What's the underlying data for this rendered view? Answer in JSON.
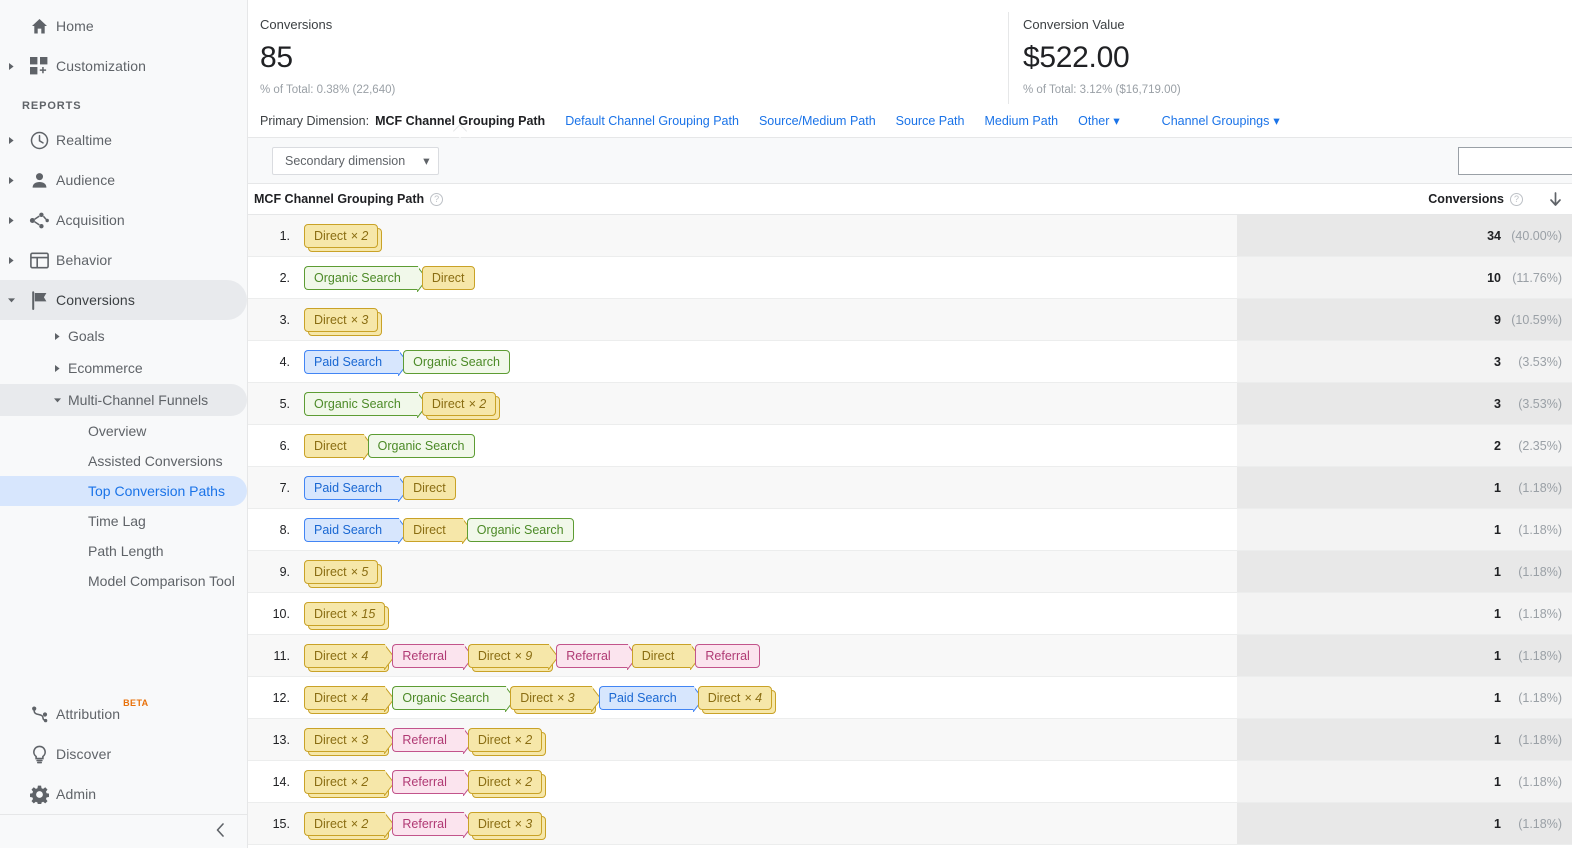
{
  "sidebar": {
    "top_items": [
      {
        "label": "Home",
        "icon": "home-icon",
        "expandable": false
      },
      {
        "label": "Customization",
        "icon": "customization-icon",
        "expandable": true
      }
    ],
    "section_label": "REPORTS",
    "report_items": [
      {
        "label": "Realtime",
        "icon": "clock-icon",
        "expandable": true,
        "active": false
      },
      {
        "label": "Audience",
        "icon": "person-icon",
        "expandable": true,
        "active": false
      },
      {
        "label": "Acquisition",
        "icon": "acquisition-icon",
        "expandable": true,
        "active": false
      },
      {
        "label": "Behavior",
        "icon": "behavior-icon",
        "expandable": true,
        "active": false
      },
      {
        "label": "Conversions",
        "icon": "flag-icon",
        "expandable": true,
        "active": true
      }
    ],
    "conversions_subitems": [
      {
        "label": "Goals",
        "expanded": false
      },
      {
        "label": "Ecommerce",
        "expanded": false
      },
      {
        "label": "Multi-Channel Funnels",
        "expanded": true
      }
    ],
    "mcf_leaves": [
      {
        "label": "Overview",
        "selected": false
      },
      {
        "label": "Assisted Conversions",
        "selected": false
      },
      {
        "label": "Top Conversion Paths",
        "selected": true
      },
      {
        "label": "Time Lag",
        "selected": false
      },
      {
        "label": "Path Length",
        "selected": false
      },
      {
        "label": "Model Comparison Tool",
        "selected": false
      }
    ],
    "bottom_items": [
      {
        "label": "Attribution",
        "icon": "attribution-icon",
        "badge": "BETA"
      },
      {
        "label": "Discover",
        "icon": "bulb-icon",
        "badge": ""
      },
      {
        "label": "Admin",
        "icon": "gear-icon",
        "badge": ""
      }
    ],
    "collapse_icon": "chevron-left-icon"
  },
  "summary": {
    "conversions": {
      "title": "Conversions",
      "value": "85",
      "percent_of_total": "% of Total: 0.38% (22,640)"
    },
    "conversion_value": {
      "title": "Conversion Value",
      "value": "$522.00",
      "percent_of_total": "% of Total: 3.12% ($16,719.00)"
    }
  },
  "dimension_bar": {
    "lead_label": "Primary Dimension:",
    "tabs": [
      {
        "label": "MCF Channel Grouping Path",
        "active": true,
        "caret": false
      },
      {
        "label": "Default Channel Grouping Path",
        "active": false,
        "caret": false
      },
      {
        "label": "Source/Medium Path",
        "active": false,
        "caret": false
      },
      {
        "label": "Source Path",
        "active": false,
        "caret": false
      },
      {
        "label": "Medium Path",
        "active": false,
        "caret": false
      },
      {
        "label": "Other",
        "active": false,
        "caret": true
      }
    ],
    "channel_groupings": {
      "label": "Channel Groupings",
      "caret": true
    }
  },
  "controls": {
    "secondary_dimension_label": "Secondary dimension",
    "search_value": "",
    "search_placeholder": ""
  },
  "table": {
    "col_path_header": "MCF Channel Grouping Path",
    "col_conv_header": "Conversions",
    "help_glyph": "?",
    "sort_icon": "arrow-down-icon",
    "rows": [
      {
        "rank": "1.",
        "conversions": "34",
        "percent": "(40.00%)",
        "path": [
          {
            "label": "Direct",
            "mult": "× 2",
            "color": "direct",
            "terminal": true
          }
        ]
      },
      {
        "rank": "2.",
        "conversions": "10",
        "percent": "(11.76%)",
        "path": [
          {
            "label": "Organic Search",
            "mult": "",
            "color": "organic",
            "terminal": false
          },
          {
            "label": "Direct",
            "mult": "",
            "color": "direct",
            "terminal": true
          }
        ]
      },
      {
        "rank": "3.",
        "conversions": "9",
        "percent": "(10.59%)",
        "path": [
          {
            "label": "Direct",
            "mult": "× 3",
            "color": "direct",
            "terminal": true
          }
        ]
      },
      {
        "rank": "4.",
        "conversions": "3",
        "percent": "(3.53%)",
        "path": [
          {
            "label": "Paid Search",
            "mult": "",
            "color": "paid",
            "terminal": false
          },
          {
            "label": "Organic Search",
            "mult": "",
            "color": "organic",
            "terminal": true
          }
        ]
      },
      {
        "rank": "5.",
        "conversions": "3",
        "percent": "(3.53%)",
        "path": [
          {
            "label": "Organic Search",
            "mult": "",
            "color": "organic",
            "terminal": false
          },
          {
            "label": "Direct",
            "mult": "× 2",
            "color": "direct",
            "terminal": true
          }
        ]
      },
      {
        "rank": "6.",
        "conversions": "2",
        "percent": "(2.35%)",
        "path": [
          {
            "label": "Direct",
            "mult": "",
            "color": "direct",
            "terminal": false
          },
          {
            "label": "Organic Search",
            "mult": "",
            "color": "organic",
            "terminal": true
          }
        ]
      },
      {
        "rank": "7.",
        "conversions": "1",
        "percent": "(1.18%)",
        "path": [
          {
            "label": "Paid Search",
            "mult": "",
            "color": "paid",
            "terminal": false
          },
          {
            "label": "Direct",
            "mult": "",
            "color": "direct",
            "terminal": true
          }
        ]
      },
      {
        "rank": "8.",
        "conversions": "1",
        "percent": "(1.18%)",
        "path": [
          {
            "label": "Paid Search",
            "mult": "",
            "color": "paid",
            "terminal": false
          },
          {
            "label": "Direct",
            "mult": "",
            "color": "direct",
            "terminal": false
          },
          {
            "label": "Organic Search",
            "mult": "",
            "color": "organic",
            "terminal": true
          }
        ]
      },
      {
        "rank": "9.",
        "conversions": "1",
        "percent": "(1.18%)",
        "path": [
          {
            "label": "Direct",
            "mult": "× 5",
            "color": "direct",
            "terminal": true
          }
        ]
      },
      {
        "rank": "10.",
        "conversions": "1",
        "percent": "(1.18%)",
        "path": [
          {
            "label": "Direct",
            "mult": "× 15",
            "color": "direct",
            "terminal": true
          }
        ]
      },
      {
        "rank": "11.",
        "conversions": "1",
        "percent": "(1.18%)",
        "path": [
          {
            "label": "Direct",
            "mult": "× 4",
            "color": "direct",
            "terminal": false
          },
          {
            "label": "Referral",
            "mult": "",
            "color": "referral",
            "terminal": false
          },
          {
            "label": "Direct",
            "mult": "× 9",
            "color": "direct",
            "terminal": false
          },
          {
            "label": "Referral",
            "mult": "",
            "color": "referral",
            "terminal": false
          },
          {
            "label": "Direct",
            "mult": "",
            "color": "direct",
            "terminal": false
          },
          {
            "label": "Referral",
            "mult": "",
            "color": "referral",
            "terminal": true
          }
        ]
      },
      {
        "rank": "12.",
        "conversions": "1",
        "percent": "(1.18%)",
        "path": [
          {
            "label": "Direct",
            "mult": "× 4",
            "color": "direct",
            "terminal": false
          },
          {
            "label": "Organic Search",
            "mult": "",
            "color": "organic",
            "terminal": false
          },
          {
            "label": "Direct",
            "mult": "× 3",
            "color": "direct",
            "terminal": false
          },
          {
            "label": "Paid Search",
            "mult": "",
            "color": "paid",
            "terminal": false
          },
          {
            "label": "Direct",
            "mult": "× 4",
            "color": "direct",
            "terminal": true
          }
        ]
      },
      {
        "rank": "13.",
        "conversions": "1",
        "percent": "(1.18%)",
        "path": [
          {
            "label": "Direct",
            "mult": "× 3",
            "color": "direct",
            "terminal": false
          },
          {
            "label": "Referral",
            "mult": "",
            "color": "referral",
            "terminal": false
          },
          {
            "label": "Direct",
            "mult": "× 2",
            "color": "direct",
            "terminal": true
          }
        ]
      },
      {
        "rank": "14.",
        "conversions": "1",
        "percent": "(1.18%)",
        "path": [
          {
            "label": "Direct",
            "mult": "× 2",
            "color": "direct",
            "terminal": false
          },
          {
            "label": "Referral",
            "mult": "",
            "color": "referral",
            "terminal": false
          },
          {
            "label": "Direct",
            "mult": "× 2",
            "color": "direct",
            "terminal": true
          }
        ]
      },
      {
        "rank": "15.",
        "conversions": "1",
        "percent": "(1.18%)",
        "path": [
          {
            "label": "Direct",
            "mult": "× 2",
            "color": "direct",
            "terminal": false
          },
          {
            "label": "Referral",
            "mult": "",
            "color": "referral",
            "terminal": false
          },
          {
            "label": "Direct",
            "mult": "× 3",
            "color": "direct",
            "terminal": true
          }
        ]
      }
    ]
  },
  "colors": {
    "accent_blue": "#1a73e8",
    "selected_bg": "#d7e6fd",
    "beta_orange": "#e8710a",
    "direct": "#c9a227",
    "organic": "#5d9c33",
    "referral": "#c2548b",
    "paid": "#4285f4"
  }
}
